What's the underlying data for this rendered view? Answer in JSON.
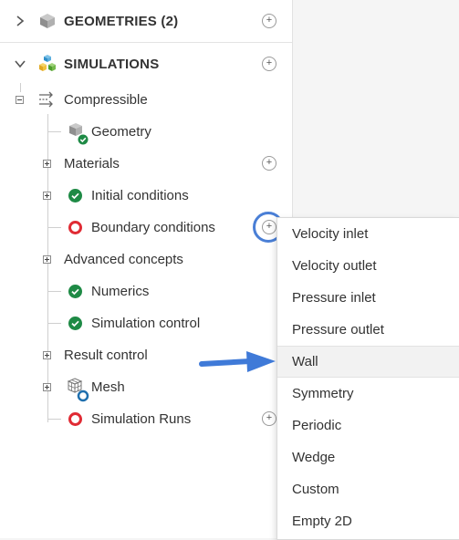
{
  "tree": {
    "geometries_title": "GEOMETRIES (2)",
    "simulations_title": "SIMULATIONS",
    "items": [
      {
        "label": "Compressible"
      },
      {
        "label": "Geometry"
      },
      {
        "label": "Materials"
      },
      {
        "label": "Initial conditions"
      },
      {
        "label": "Boundary conditions"
      },
      {
        "label": "Advanced concepts"
      },
      {
        "label": "Numerics"
      },
      {
        "label": "Simulation control"
      },
      {
        "label": "Result control"
      },
      {
        "label": "Mesh"
      },
      {
        "label": "Simulation Runs"
      }
    ]
  },
  "context_menu": {
    "items": [
      {
        "label": "Velocity inlet"
      },
      {
        "label": "Velocity outlet"
      },
      {
        "label": "Pressure inlet"
      },
      {
        "label": "Pressure outlet"
      },
      {
        "label": "Wall"
      },
      {
        "label": "Symmetry"
      },
      {
        "label": "Periodic"
      },
      {
        "label": "Wedge"
      },
      {
        "label": "Custom"
      },
      {
        "label": "Empty 2D"
      }
    ]
  },
  "colors": {
    "ok": "#1e8a45",
    "error": "#e02b34",
    "highlight": "#4a7fd6",
    "arrow": "#3f7ad8"
  }
}
